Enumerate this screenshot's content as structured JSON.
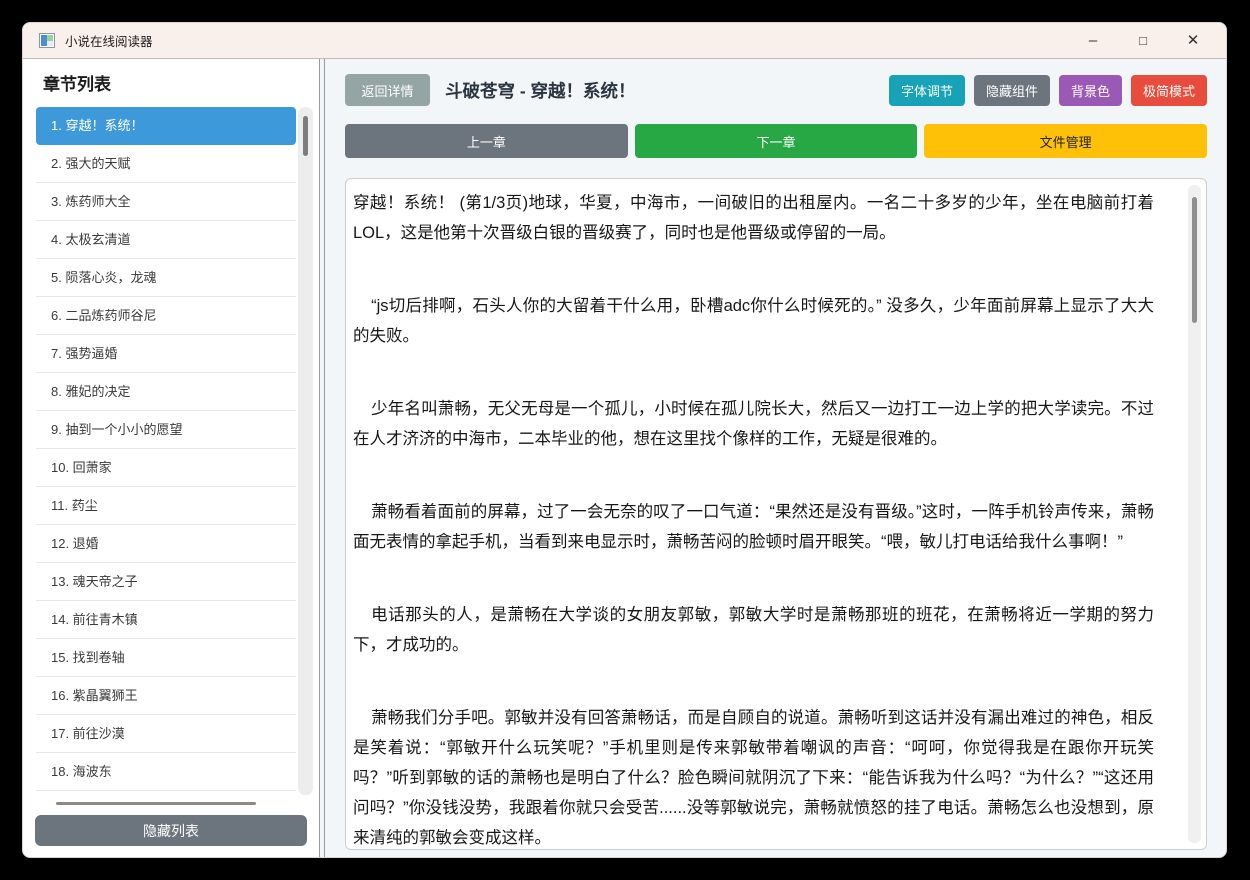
{
  "window": {
    "title": "小说在线阅读器",
    "controls": {
      "minimize": "–",
      "maximize": "□",
      "close": "✕"
    },
    "titlebar_color": "#f9efeb"
  },
  "sidebar": {
    "title": "章节列表",
    "selected_index": 0,
    "selected_color": "#3e99da",
    "chapters": [
      "1. 穿越！系统！",
      "2. 强大的天赋",
      "3. 炼药师大全",
      "4. 太极玄清道",
      "5. 陨落心炎，龙魂",
      "6. 二品炼药师谷尼",
      "7. 强势逼婚",
      "8. 雅妃的决定",
      "9. 抽到一个小小的愿望",
      "10. 回萧家",
      "11. 药尘",
      "12. 退婚",
      "13. 魂天帝之子",
      "14. 前往青木镇",
      "15. 找到卷轴",
      "16. 紫晶翼狮王",
      "17. 前往沙漠",
      "18. 海波东"
    ],
    "hide_list_button": "隐藏列表",
    "hide_list_color": "#6c757d"
  },
  "header": {
    "back_button": "返回详情",
    "back_color": "#95a5a6",
    "book_title": "斗破苍穹 - 穿越！系统！",
    "tool_buttons": [
      {
        "name": "font-adjust-button",
        "label": "字体调节",
        "color": "#17a2b8"
      },
      {
        "name": "hide-components-button",
        "label": "隐藏组件",
        "color": "#6c757d"
      },
      {
        "name": "background-color-button",
        "label": "背景色",
        "color": "#9b59b6"
      },
      {
        "name": "minimal-mode-button",
        "label": "极简模式",
        "color": "#e74c3c"
      }
    ]
  },
  "nav": {
    "prev_button": "上一章",
    "prev_color": "#6c757d",
    "next_button": "下一章",
    "next_color": "#28a745",
    "file_button": "文件管理",
    "file_color": "#ffc107"
  },
  "reader": {
    "paragraphs": [
      "穿越！系统！ (第1/3页)地球，华夏，中海市，一间破旧的出租屋内。一名二十多岁的少年，坐在电脑前打着LOL，这是他第十次晋级白银的晋级赛了，同时也是他晋级或停留的一局。",
      "“js切后排啊，石头人你的大留着干什么用，卧槽adc你什么时候死的。” 没多久，少年面前屏幕上显示了大大的失败。",
      "少年名叫萧畅，无父无母是一个孤儿，小时候在孤儿院长大，然后又一边打工一边上学的把大学读完。不过在人才济济的中海市，二本毕业的他，想在这里找个像样的工作，无疑是很难的。",
      "萧畅看着面前的屏幕，过了一会无奈的叹了一口气道：“果然还是没有晋级。”这时，一阵手机铃声传来，萧畅面无表情的拿起手机，当看到来电显示时，萧畅苦闷的脸顿时眉开眼笑。“喂，敏儿打电话给我什么事啊！”",
      "电话那头的人，是萧畅在大学谈的女朋友郭敏，郭敏大学时是萧畅那班的班花，在萧畅将近一学期的努力下，才成功的。",
      "萧畅我们分手吧。郭敏并没有回答萧畅话，而是自顾自的说道。萧畅听到这话并没有漏出难过的神色，相反是笑着说：“郭敏开什么玩笑呢？”手机里则是传来郭敏带着嘲讽的声音：“呵呵，你觉得我是在跟你开玩笑吗？”听到郭敏的话的萧畅也是明白了什么？脸色瞬间就阴沉了下来：“能告诉我为什么吗？“为什么？”“这还用问吗？”你没钱没势，我跟着你就只会受苦......没等郭敏说完，萧畅就愤怒的挂了电话。萧畅怎么也没想到，原来清纯的郭敏会变成这样。"
    ]
  }
}
